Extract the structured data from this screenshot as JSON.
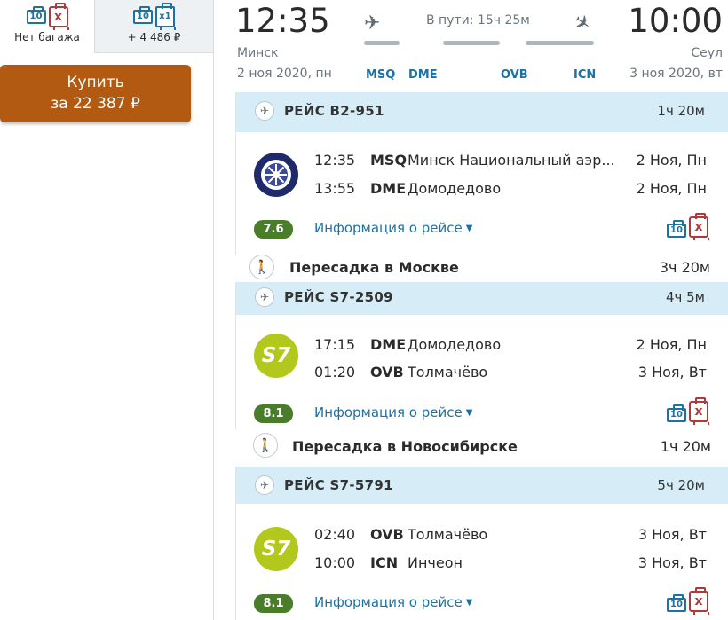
{
  "baggage_options": [
    {
      "caption": "Нет багажа",
      "hand_count": "10",
      "checked": "x"
    },
    {
      "caption": "+ 4 486 ₽",
      "hand_count": "10",
      "checked": "x1"
    }
  ],
  "buy": {
    "line1": "Купить",
    "line2": "за 22 387 ₽"
  },
  "header": {
    "dep_time": "12:35",
    "arr_time": "10:00",
    "dep_city": "Минск",
    "arr_city": "Сеул",
    "dep_date": "2 ноя 2020, пн",
    "arr_date": "3 ноя 2020, вт",
    "transit": "В пути: 15ч 25м",
    "codes": [
      "MSQ",
      "DME",
      "OVB",
      "ICN"
    ]
  },
  "segments": [
    {
      "flight": "РЕЙС B2-951",
      "duration": "1ч 20м",
      "logo": "belavia-logo",
      "logo_text": "",
      "rows": [
        {
          "time": "12:35",
          "code": "MSQ",
          "name": "Минск Национальный аэр...",
          "date": "2 Ноя, Пн"
        },
        {
          "time": "13:55",
          "code": "DME",
          "name": "Домодедово",
          "date": "2 Ноя, Пн"
        }
      ],
      "rating": "7.6",
      "info": "Информация о рейсе",
      "hand_bag": "10",
      "checked_bag": "x"
    },
    {
      "flight": "РЕЙС S7-2509",
      "duration": "4ч 5м",
      "logo": "s7-logo",
      "logo_text": "S7",
      "rows": [
        {
          "time": "17:15",
          "code": "DME",
          "name": "Домодедово",
          "date": "2 Ноя, Пн"
        },
        {
          "time": "01:20",
          "code": "OVB",
          "name": "Толмачёво",
          "date": "3 Ноя, Вт"
        }
      ],
      "rating": "8.1",
      "info": "Информация о рейсе",
      "hand_bag": "10",
      "checked_bag": "x"
    },
    {
      "flight": "РЕЙС S7-5791",
      "duration": "5ч 20м",
      "logo": "s7-logo",
      "logo_text": "S7",
      "rows": [
        {
          "time": "02:40",
          "code": "OVB",
          "name": "Толмачёво",
          "date": "3 Ноя, Вт"
        },
        {
          "time": "10:00",
          "code": "ICN",
          "name": "Инчеон",
          "date": "3 Ноя, Вт"
        }
      ],
      "rating": "8.1",
      "info": "Информация о рейсе",
      "hand_bag": "10",
      "checked_bag": "x"
    }
  ],
  "transfers": [
    {
      "label": "Пересадка в Москве",
      "duration": "3ч 20м"
    },
    {
      "label": "Пересадка в Новосибирске",
      "duration": "1ч 20м"
    }
  ],
  "colors": {
    "buy_button": "#b35a12",
    "segment_header": "#d6ecf6",
    "rating": "#4a7d29",
    "link": "#1a72a6",
    "s7": "#b2c81c",
    "belavia": "#1f2a6b"
  }
}
